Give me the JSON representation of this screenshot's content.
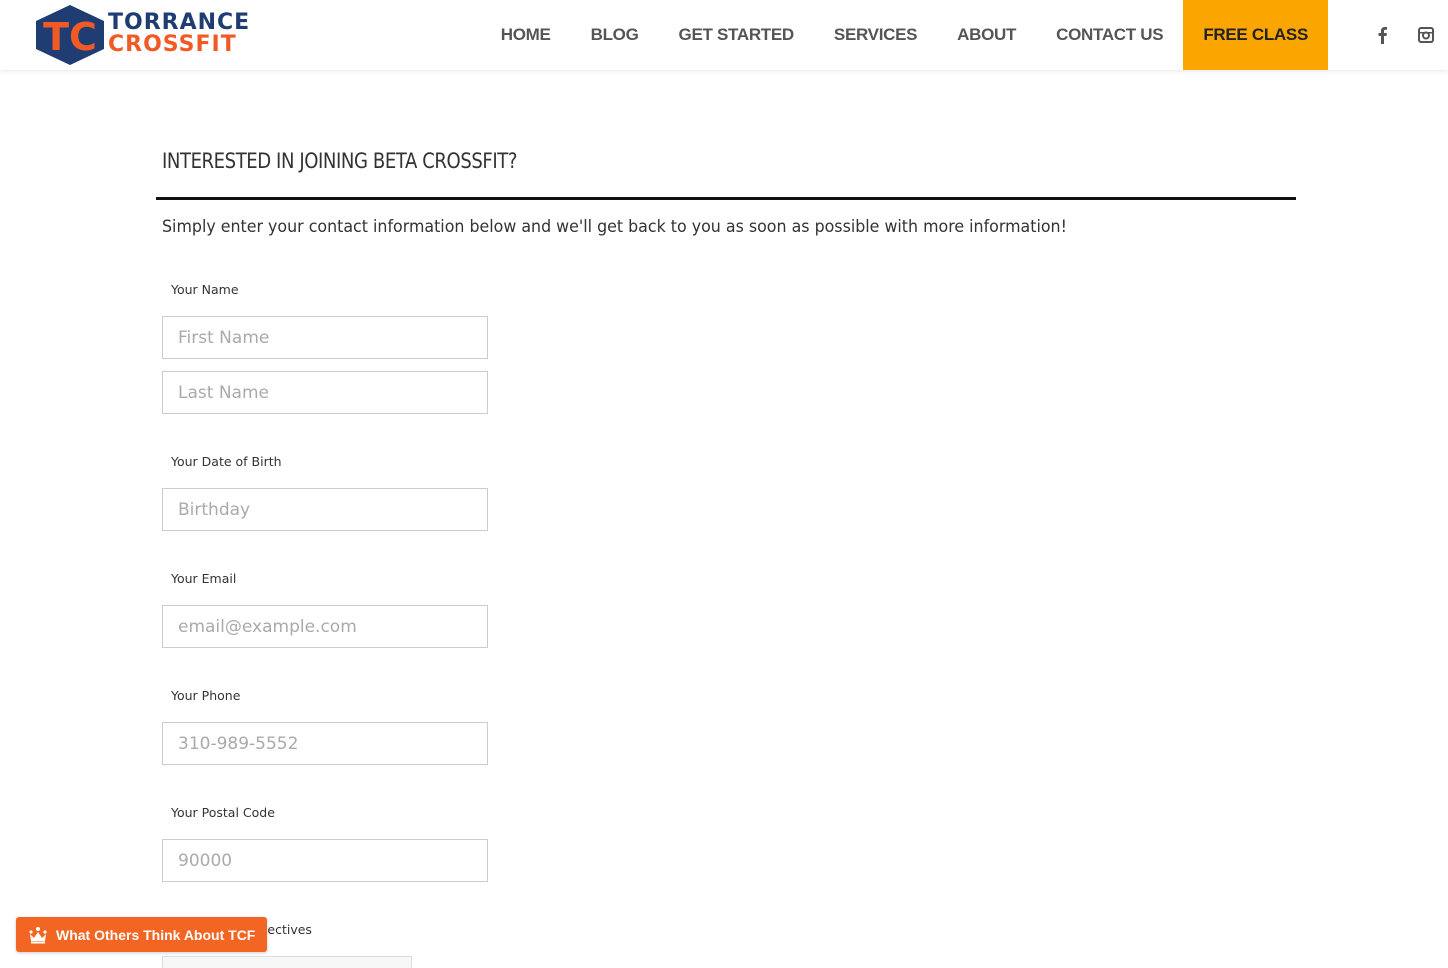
{
  "brand": {
    "logo_mark": "TC",
    "logo_line1": "TORRANCE",
    "logo_line2": "CROSSFIT",
    "colors": {
      "navy": "#1f3c73",
      "orange": "#f15a24",
      "cta": "#fba600"
    }
  },
  "nav": {
    "items": [
      {
        "label": "HOME"
      },
      {
        "label": "BLOG"
      },
      {
        "label": "GET STARTED"
      },
      {
        "label": "SERVICES"
      },
      {
        "label": "ABOUT"
      },
      {
        "label": "CONTACT US"
      }
    ],
    "cta_label": "FREE CLASS",
    "social": [
      {
        "icon": "facebook-icon"
      },
      {
        "icon": "instagram-icon"
      }
    ]
  },
  "main": {
    "title": "INTERESTED IN JOINING BETA CROSSFIT?",
    "intro": "Simply enter your contact information below and we'll get back to you as soon as possible with more information!",
    "form": {
      "name_label": "Your Name",
      "first_name_placeholder": "First Name",
      "last_name_placeholder": "Last Name",
      "dob_label": "Your Date of Birth",
      "dob_placeholder": "Birthday",
      "email_label": "Your Email",
      "email_placeholder": "email@example.com",
      "phone_label": "Your Phone",
      "phone_placeholder": "310-989-5552",
      "postal_label": "Your Postal Code",
      "postal_placeholder": "90000",
      "objectives_label_visible": "bjectives"
    }
  },
  "review_widget": {
    "label": "What Others Think About TCF",
    "icon": "crown-icon"
  }
}
